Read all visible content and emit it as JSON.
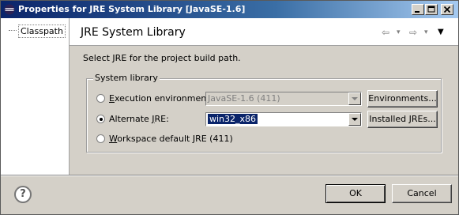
{
  "window": {
    "title": "Properties for JRE System Library [JavaSE-1.6]",
    "buttons": {
      "minimize": "_",
      "maximize": "□",
      "close": "×"
    }
  },
  "nav": {
    "items": [
      {
        "label": "Classpath"
      }
    ]
  },
  "page": {
    "title": "JRE System Library",
    "description": "Select JRE for the project build path.",
    "history": {
      "back": "⇦",
      "back_menu": "▾",
      "forward": "⇨",
      "forward_menu": "▾",
      "view_menu": "▼"
    }
  },
  "group": {
    "legend": "System library",
    "options": [
      {
        "mnemonic": "E",
        "label_rest": "xecution environment:",
        "selected": false,
        "combo_value": "JavaSE-1.6 (411)",
        "combo_enabled": false,
        "button_label": "Environments..."
      },
      {
        "label_pre": "Alternate ",
        "mnemonic": "J",
        "label_rest": "RE:",
        "selected": true,
        "combo_value": "win32_x86",
        "combo_enabled": true,
        "button_label": "Installed JREs..."
      },
      {
        "mnemonic": "W",
        "label_rest": "orkspace default JRE (411)",
        "selected": false
      }
    ]
  },
  "footer": {
    "help": "?",
    "ok": "OK",
    "cancel": "Cancel"
  }
}
